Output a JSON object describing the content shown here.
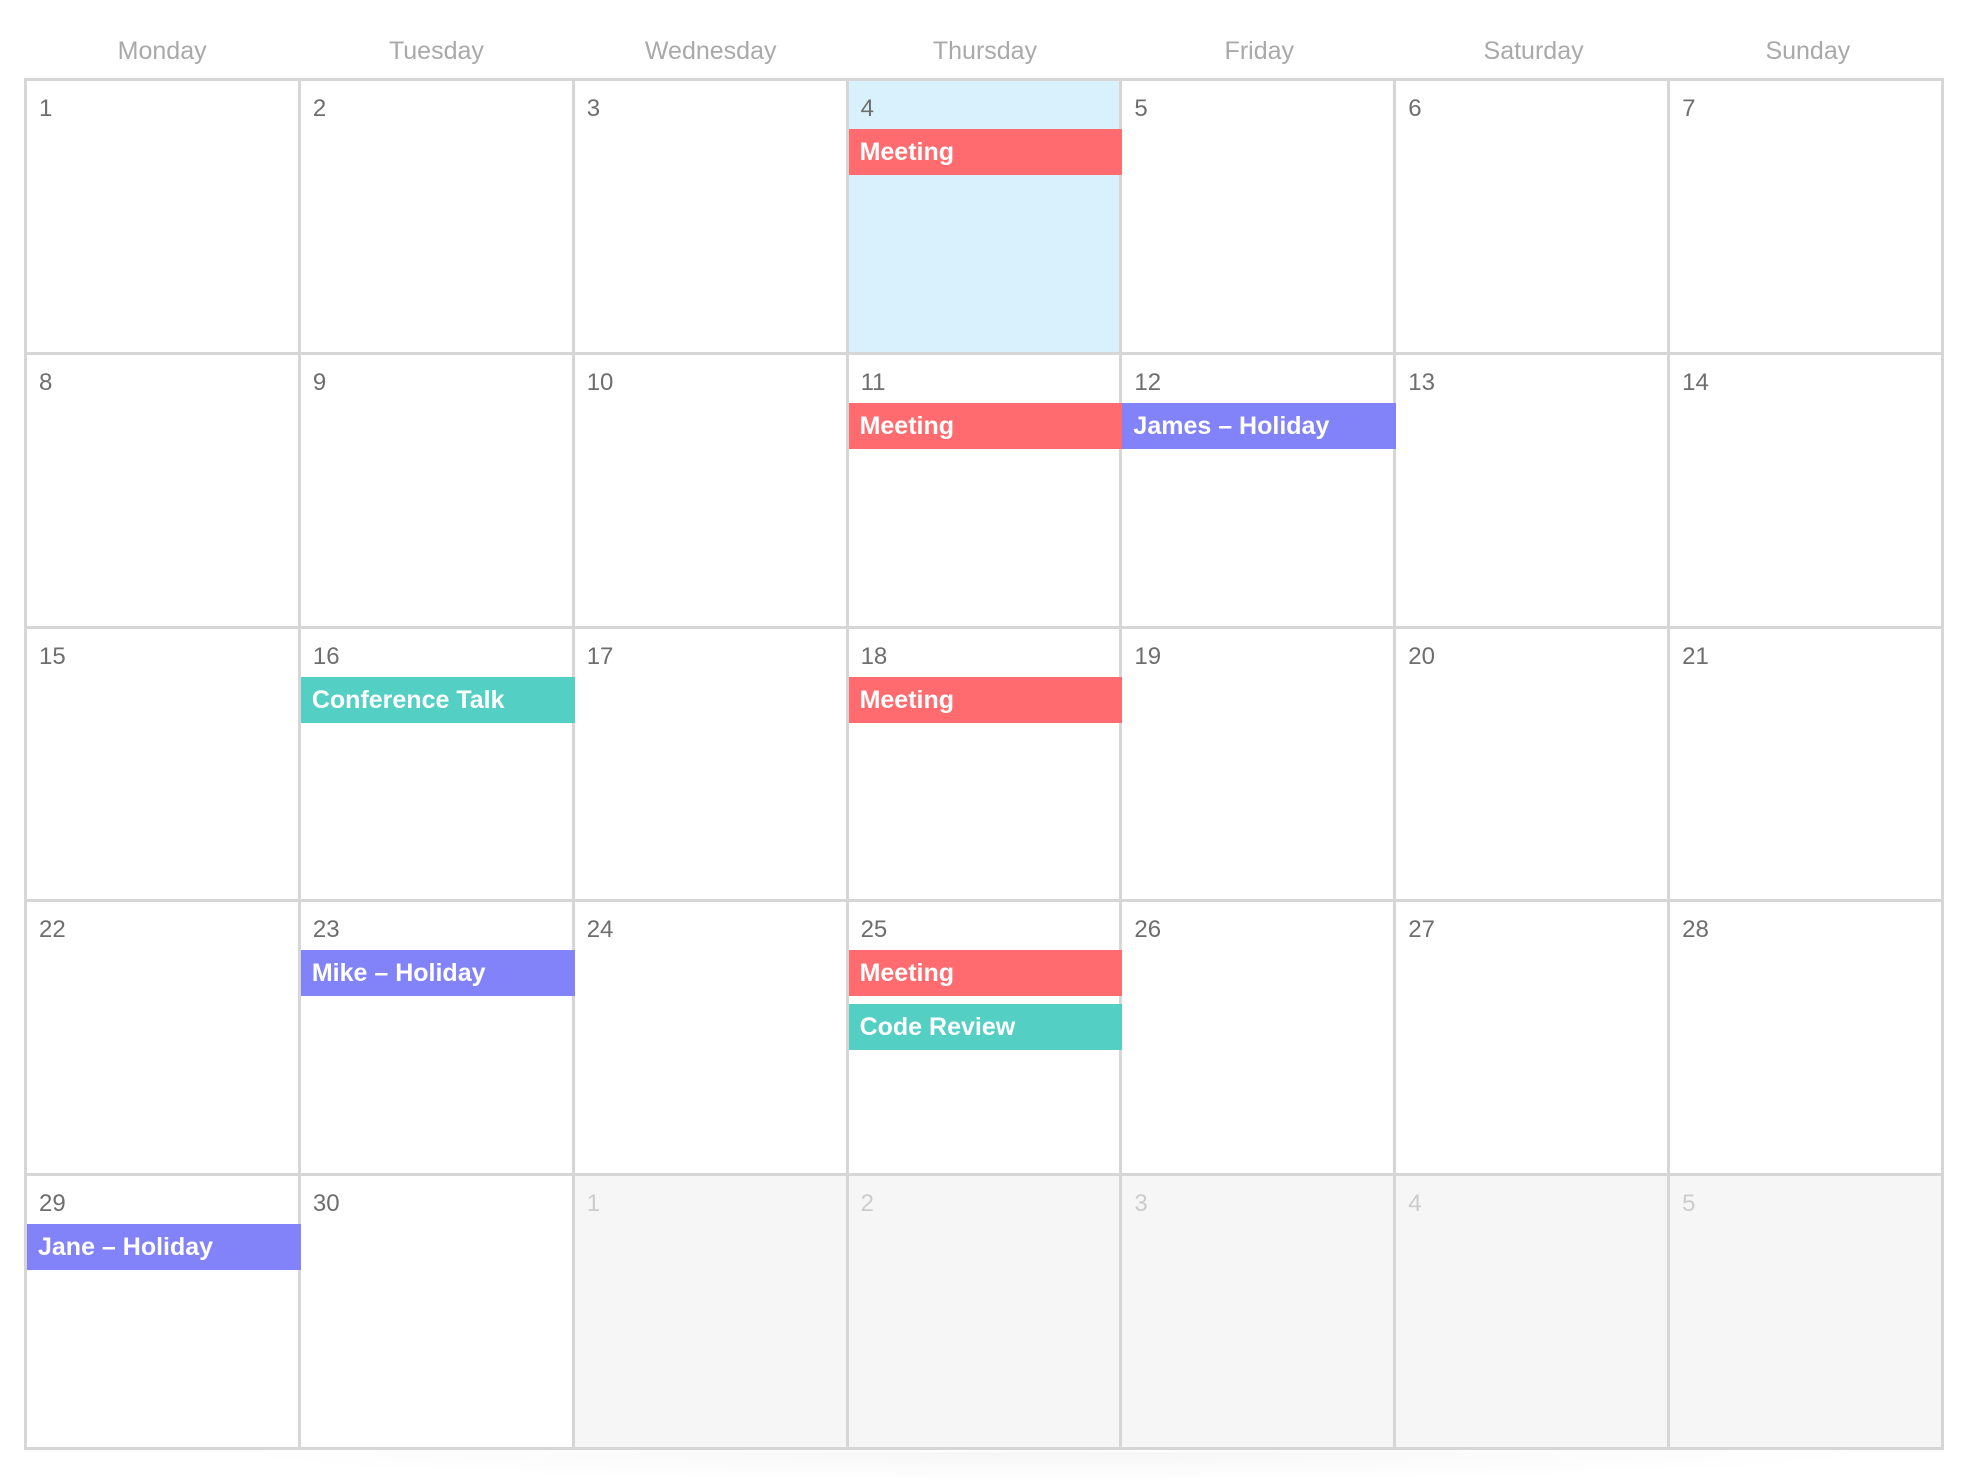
{
  "weekdays": [
    "Monday",
    "Tuesday",
    "Wednesday",
    "Thursday",
    "Friday",
    "Saturday",
    "Sunday"
  ],
  "colors": {
    "meeting": "#ff6b6e",
    "holiday": "#8282f9",
    "work": "#54cfc4",
    "today_bg": "#d9f1fc",
    "other_month_bg": "#f6f6f6"
  },
  "weeks": [
    [
      {
        "day": "1",
        "events": []
      },
      {
        "day": "2",
        "events": []
      },
      {
        "day": "3",
        "events": []
      },
      {
        "day": "4",
        "today": true,
        "events": [
          {
            "title": "Meeting",
            "type": "meeting"
          }
        ]
      },
      {
        "day": "5",
        "events": []
      },
      {
        "day": "6",
        "events": []
      },
      {
        "day": "7",
        "events": []
      }
    ],
    [
      {
        "day": "8",
        "events": []
      },
      {
        "day": "9",
        "events": []
      },
      {
        "day": "10",
        "events": []
      },
      {
        "day": "11",
        "events": [
          {
            "title": "Meeting",
            "type": "meeting"
          }
        ]
      },
      {
        "day": "12",
        "events": [
          {
            "title": "James – Holiday",
            "type": "holiday"
          }
        ]
      },
      {
        "day": "13",
        "events": []
      },
      {
        "day": "14",
        "events": []
      }
    ],
    [
      {
        "day": "15",
        "events": []
      },
      {
        "day": "16",
        "events": [
          {
            "title": "Conference Talk",
            "type": "work"
          }
        ]
      },
      {
        "day": "17",
        "events": []
      },
      {
        "day": "18",
        "events": [
          {
            "title": "Meeting",
            "type": "meeting"
          }
        ]
      },
      {
        "day": "19",
        "events": []
      },
      {
        "day": "20",
        "events": []
      },
      {
        "day": "21",
        "events": []
      }
    ],
    [
      {
        "day": "22",
        "events": []
      },
      {
        "day": "23",
        "events": [
          {
            "title": "Mike – Holiday",
            "type": "holiday"
          }
        ]
      },
      {
        "day": "24",
        "events": []
      },
      {
        "day": "25",
        "events": [
          {
            "title": "Meeting",
            "type": "meeting"
          },
          {
            "title": "Code Review",
            "type": "work"
          }
        ]
      },
      {
        "day": "26",
        "events": []
      },
      {
        "day": "27",
        "events": []
      },
      {
        "day": "28",
        "events": []
      }
    ],
    [
      {
        "day": "29",
        "events": [
          {
            "title": "Jane – Holiday",
            "type": "holiday"
          }
        ]
      },
      {
        "day": "30",
        "events": []
      },
      {
        "day": "1",
        "other_month": true,
        "events": []
      },
      {
        "day": "2",
        "other_month": true,
        "events": []
      },
      {
        "day": "3",
        "other_month": true,
        "events": []
      },
      {
        "day": "4",
        "other_month": true,
        "events": []
      },
      {
        "day": "5",
        "other_month": true,
        "events": []
      }
    ]
  ]
}
